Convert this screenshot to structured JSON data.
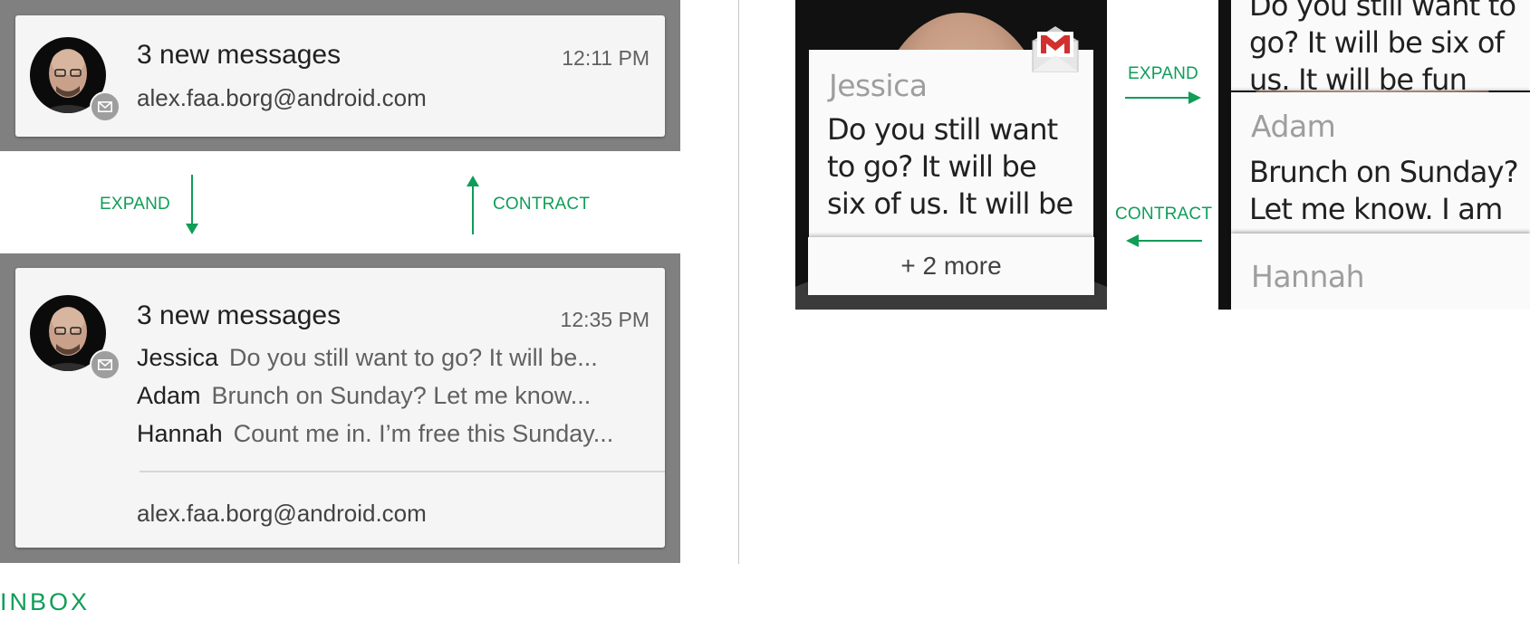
{
  "phone": {
    "collapsed": {
      "title": "3 new messages",
      "time": "12:11 PM",
      "account": "alex.faa.borg@android.com"
    },
    "expanded": {
      "title": "3 new messages",
      "time": "12:35 PM",
      "messages": [
        {
          "sender": "Jessica",
          "snippet": "Do you still want to go? It will be..."
        },
        {
          "sender": "Adam",
          "snippet": "Brunch on Sunday? Let me know..."
        },
        {
          "sender": "Hannah",
          "snippet": "Count me in. I’m free this Sunday..."
        }
      ],
      "account": "alex.faa.borg@android.com"
    },
    "expand_label": "EXPAND",
    "contract_label": "CONTRACT"
  },
  "watch": {
    "collapsed": {
      "sender": "Jessica",
      "text": "Do you still want to go? It will be six of us. It will be fun and often and let me know",
      "more": "+ 2 more"
    },
    "expand_label": "EXPAND",
    "contract_label": "CONTRACT",
    "expanded": {
      "prev_text": "Do you still want to go? It will be six of us. It will be fun and often and let",
      "cards": [
        {
          "sender": "Adam",
          "text": "Brunch on Sunday? Let me know. I am"
        },
        {
          "sender": "Hannah"
        }
      ]
    }
  },
  "caption": "INBOX",
  "colors": {
    "accent_green": "#0f9d58",
    "shade_gray": "#808080",
    "card_bg": "#f5f5f5",
    "gmail_red": "#d32f2f"
  },
  "icons": [
    "gmail-badge-icon",
    "gmail-envelope-icon",
    "arrow-down-icon",
    "arrow-up-icon",
    "arrow-right-icon",
    "arrow-left-icon"
  ]
}
